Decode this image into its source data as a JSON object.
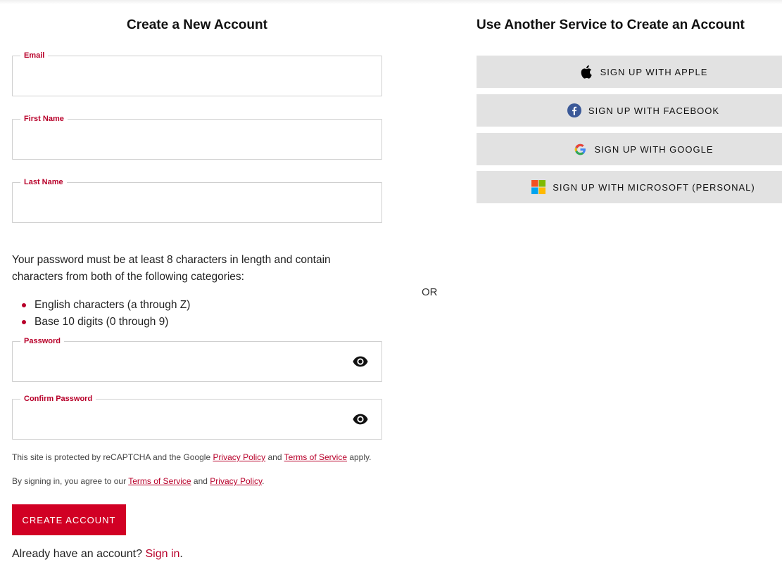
{
  "left": {
    "title": "Create a New Account",
    "fields": {
      "email": {
        "label": "Email",
        "value": ""
      },
      "first_name": {
        "label": "First Name",
        "value": ""
      },
      "last_name": {
        "label": "Last Name",
        "value": ""
      },
      "password": {
        "label": "Password",
        "value": ""
      },
      "confirm_password": {
        "label": "Confirm Password",
        "value": ""
      }
    },
    "password_rules": {
      "intro": "Your password must be at least 8 characters in length and contain characters from both of the following categories:",
      "items": [
        "English characters (a through Z)",
        "Base 10 digits (0 through 9)"
      ]
    },
    "recaptcha": {
      "pre": "This site is protected by reCAPTCHA and the Google ",
      "privacy": "Privacy Policy",
      "mid": " and ",
      "terms": "Terms of Service",
      "post": " apply."
    },
    "agreement": {
      "pre": "By signing in, you agree to our ",
      "terms": "Terms of Service",
      "mid": " and ",
      "privacy": "Privacy Policy",
      "post": "."
    },
    "create_button": "CREATE ACCOUNT",
    "signin": {
      "pre": "Already have an account? ",
      "link": "Sign in",
      "post": "."
    }
  },
  "or_label": "OR",
  "right": {
    "title": "Use Another Service to Create an Account",
    "buttons": [
      {
        "label": "SIGN UP WITH APPLE",
        "icon": "apple-icon"
      },
      {
        "label": "SIGN UP WITH FACEBOOK",
        "icon": "facebook-icon"
      },
      {
        "label": "SIGN UP WITH GOOGLE",
        "icon": "google-icon"
      },
      {
        "label": "SIGN UP WITH MICROSOFT (PERSONAL)",
        "icon": "microsoft-icon"
      }
    ]
  },
  "colors": {
    "accent": "#b8002a",
    "button": "#d10024",
    "social_bg": "#e2e2e2",
    "facebook": "#3b5998"
  }
}
